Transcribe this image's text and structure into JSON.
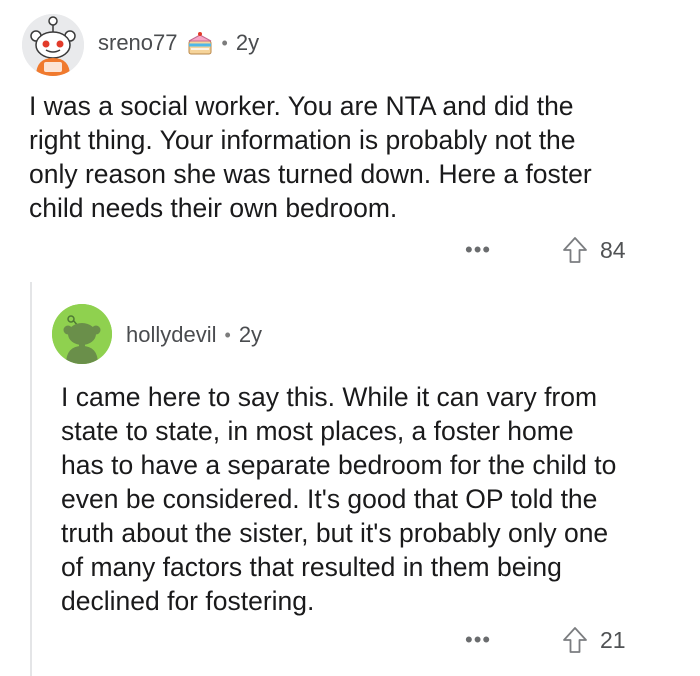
{
  "comments": [
    {
      "username": "sreno77",
      "age": "2y",
      "separator": "•",
      "avatar_icon": "snoo-avatar-icon",
      "flair_icon": "cake-day-icon",
      "body": "I was a social worker. You are NTA and did the\nright thing. Your information is probably not the\nonly reason she was turned down. Here a foster\nchild needs their own bedroom.",
      "more": "•••",
      "score": "84"
    },
    {
      "username": "hollydevil",
      "age": "2y",
      "separator": "•",
      "avatar_icon": "snoo-avatar-icon",
      "body": "I came here to say this. While it can vary from\nstate to state, in most places, a foster home\nhas to have a separate bedroom for the child to\neven be considered.   It's good that OP told the\ntruth about the sister, but it's probably only one\nof many factors that resulted in them being\ndeclined for fostering.",
      "more": "•••",
      "score": "21"
    }
  ],
  "colors": {
    "avatar1_bg": "#e9eaec",
    "avatar2_bg": "#8fd14f",
    "text": "#1a1a1b",
    "meta": "#4a4c4f"
  }
}
